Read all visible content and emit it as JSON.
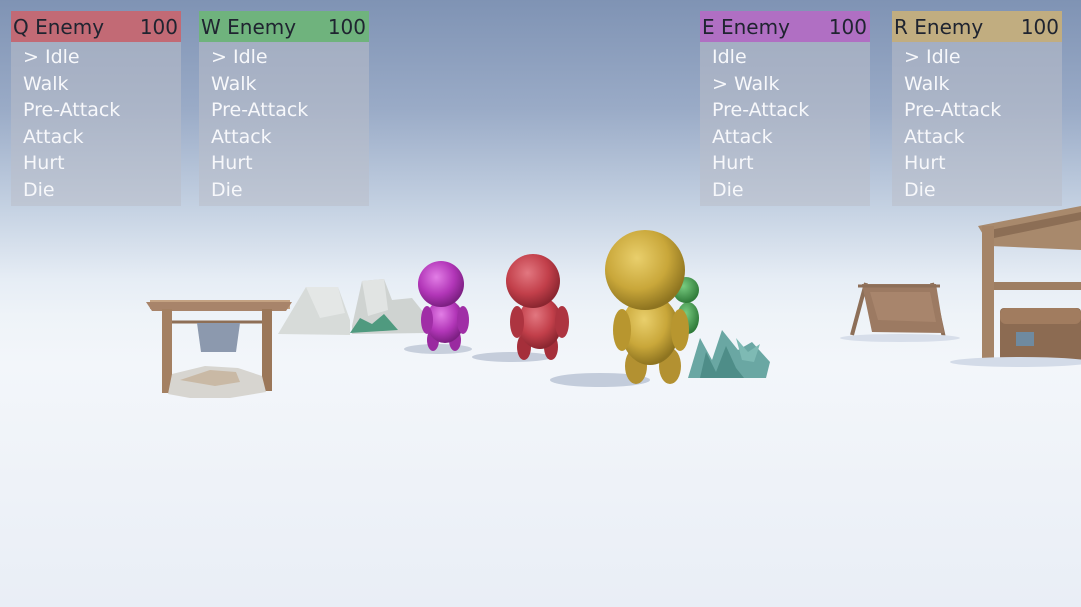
{
  "panels": [
    {
      "key": "q",
      "title": "Q Enemy",
      "hp": "100",
      "color": "#c26a75",
      "states": [
        "> Idle",
        "Walk",
        "Pre-Attack",
        "Attack",
        "Hurt",
        "Die"
      ]
    },
    {
      "key": "w",
      "title": "W Enemy",
      "hp": "100",
      "color": "#6fb37d",
      "states": [
        "> Idle",
        "Walk",
        "Pre-Attack",
        "Attack",
        "Hurt",
        "Die"
      ]
    },
    {
      "key": "e",
      "title": "E Enemy",
      "hp": "100",
      "color": "#b06fc3",
      "states": [
        "Idle",
        "> Walk",
        "Pre-Attack",
        "Attack",
        "Hurt",
        "Die"
      ]
    },
    {
      "key": "r",
      "title": "R Enemy",
      "hp": "100",
      "color": "#c1ad80",
      "states": [
        "> Idle",
        "Walk",
        "Pre-Attack",
        "Attack",
        "Hurt",
        "Die"
      ]
    }
  ],
  "characters": {
    "purple": "#b236b8",
    "red": "#c23f4a",
    "yellow": "#c9a73a",
    "green": "#3f9a4a"
  }
}
